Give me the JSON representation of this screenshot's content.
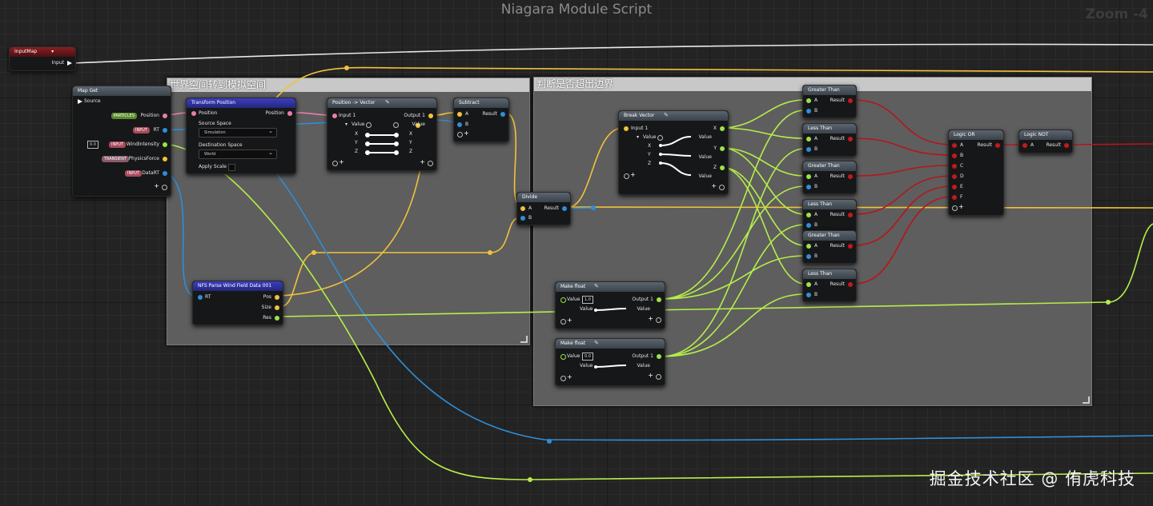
{
  "window_title": "Niagara Module Script",
  "zoom_label": "Zoom -4",
  "watermark": "掘金技术社区 @ 侑虎科技",
  "comments": {
    "world_to_sim": "世界空间转到模拟空间",
    "out_of_bounds": "判断是否超出边界"
  },
  "nodes": {
    "input_map": {
      "title": "InputMap",
      "out_pin": "Input"
    },
    "map_get": {
      "title": "Map Get",
      "source": "Source",
      "rows": [
        {
          "tag": "PARTICLES",
          "label": "Position"
        },
        {
          "tag": "INPUT",
          "label": "RT"
        },
        {
          "tag": "INPUT",
          "label": "WindIntensity",
          "value": "0.0"
        },
        {
          "tag": "TRANSIENT",
          "label": "PhysicsForce"
        },
        {
          "tag": "INPUT",
          "label": "DataRT"
        }
      ]
    },
    "transform_position": {
      "title": "Transform Position",
      "in_pin": "Position",
      "out_pin": "Position",
      "source_space_label": "Source Space",
      "source_space_value": "Simulation",
      "dest_space_label": "Destination Space",
      "dest_space_value": "World",
      "apply_scale": "Apply Scale"
    },
    "pos_to_vec": {
      "title": "Position -> Vector",
      "in_pin": "Input 1",
      "out_pin": "Output 1",
      "value": "Value",
      "axes": [
        "X",
        "Y",
        "Z"
      ]
    },
    "subtract": {
      "title": "Subtract",
      "a": "A",
      "b": "B",
      "result": "Result"
    },
    "divide": {
      "title": "Divide",
      "a": "A",
      "b": "B",
      "result": "Result"
    },
    "nfs_parse": {
      "title": "NFS Parse Wind Field Data 001",
      "in_pin": "RT",
      "outs": [
        "Pos",
        "Size",
        "Res"
      ]
    },
    "break_vector": {
      "title": "Break Vector",
      "in_pin": "Input 1",
      "value": "Value",
      "axes": [
        "X",
        "Y",
        "Z"
      ],
      "outs": [
        "X",
        "Y",
        "Z"
      ],
      "value_labels": [
        "Value",
        "Value",
        "Value"
      ]
    },
    "make_float_1": {
      "title": "Make float",
      "value_label": "Value",
      "value": "1.0",
      "out_pin": "Output 1",
      "slider_label": "Value",
      "out_value": "Value"
    },
    "make_float_0": {
      "title": "Make float",
      "value_label": "Value",
      "value": "0.0",
      "out_pin": "Output 1",
      "slider_label": "Value",
      "out_value": "Value"
    },
    "compares": [
      {
        "title": "Greater Than",
        "a": "A",
        "b": "B",
        "result": "Result"
      },
      {
        "title": "Less Than",
        "a": "A",
        "b": "B",
        "result": "Result"
      },
      {
        "title": "Greater Than",
        "a": "A",
        "b": "B",
        "result": "Result"
      },
      {
        "title": "Less Than",
        "a": "A",
        "b": "B",
        "result": "Result"
      },
      {
        "title": "Greater Than",
        "a": "A",
        "b": "B",
        "result": "Result"
      },
      {
        "title": "Less Than",
        "a": "A",
        "b": "B",
        "result": "Result"
      }
    ],
    "logic_or": {
      "title": "Logic OR",
      "ins": [
        "A",
        "B",
        "C",
        "D",
        "E",
        "F"
      ],
      "result": "Result"
    },
    "logic_not": {
      "title": "Logic NOT",
      "a": "A",
      "result": "Result"
    }
  },
  "colors": {
    "position_pin": "#e97fa9",
    "texture_pin": "#2f8ed8",
    "vector_pin": "#f1c23b",
    "float_pin": "#9fe04a",
    "bool_pin": "#c21a1a",
    "exec_pin": "#ffffff"
  }
}
